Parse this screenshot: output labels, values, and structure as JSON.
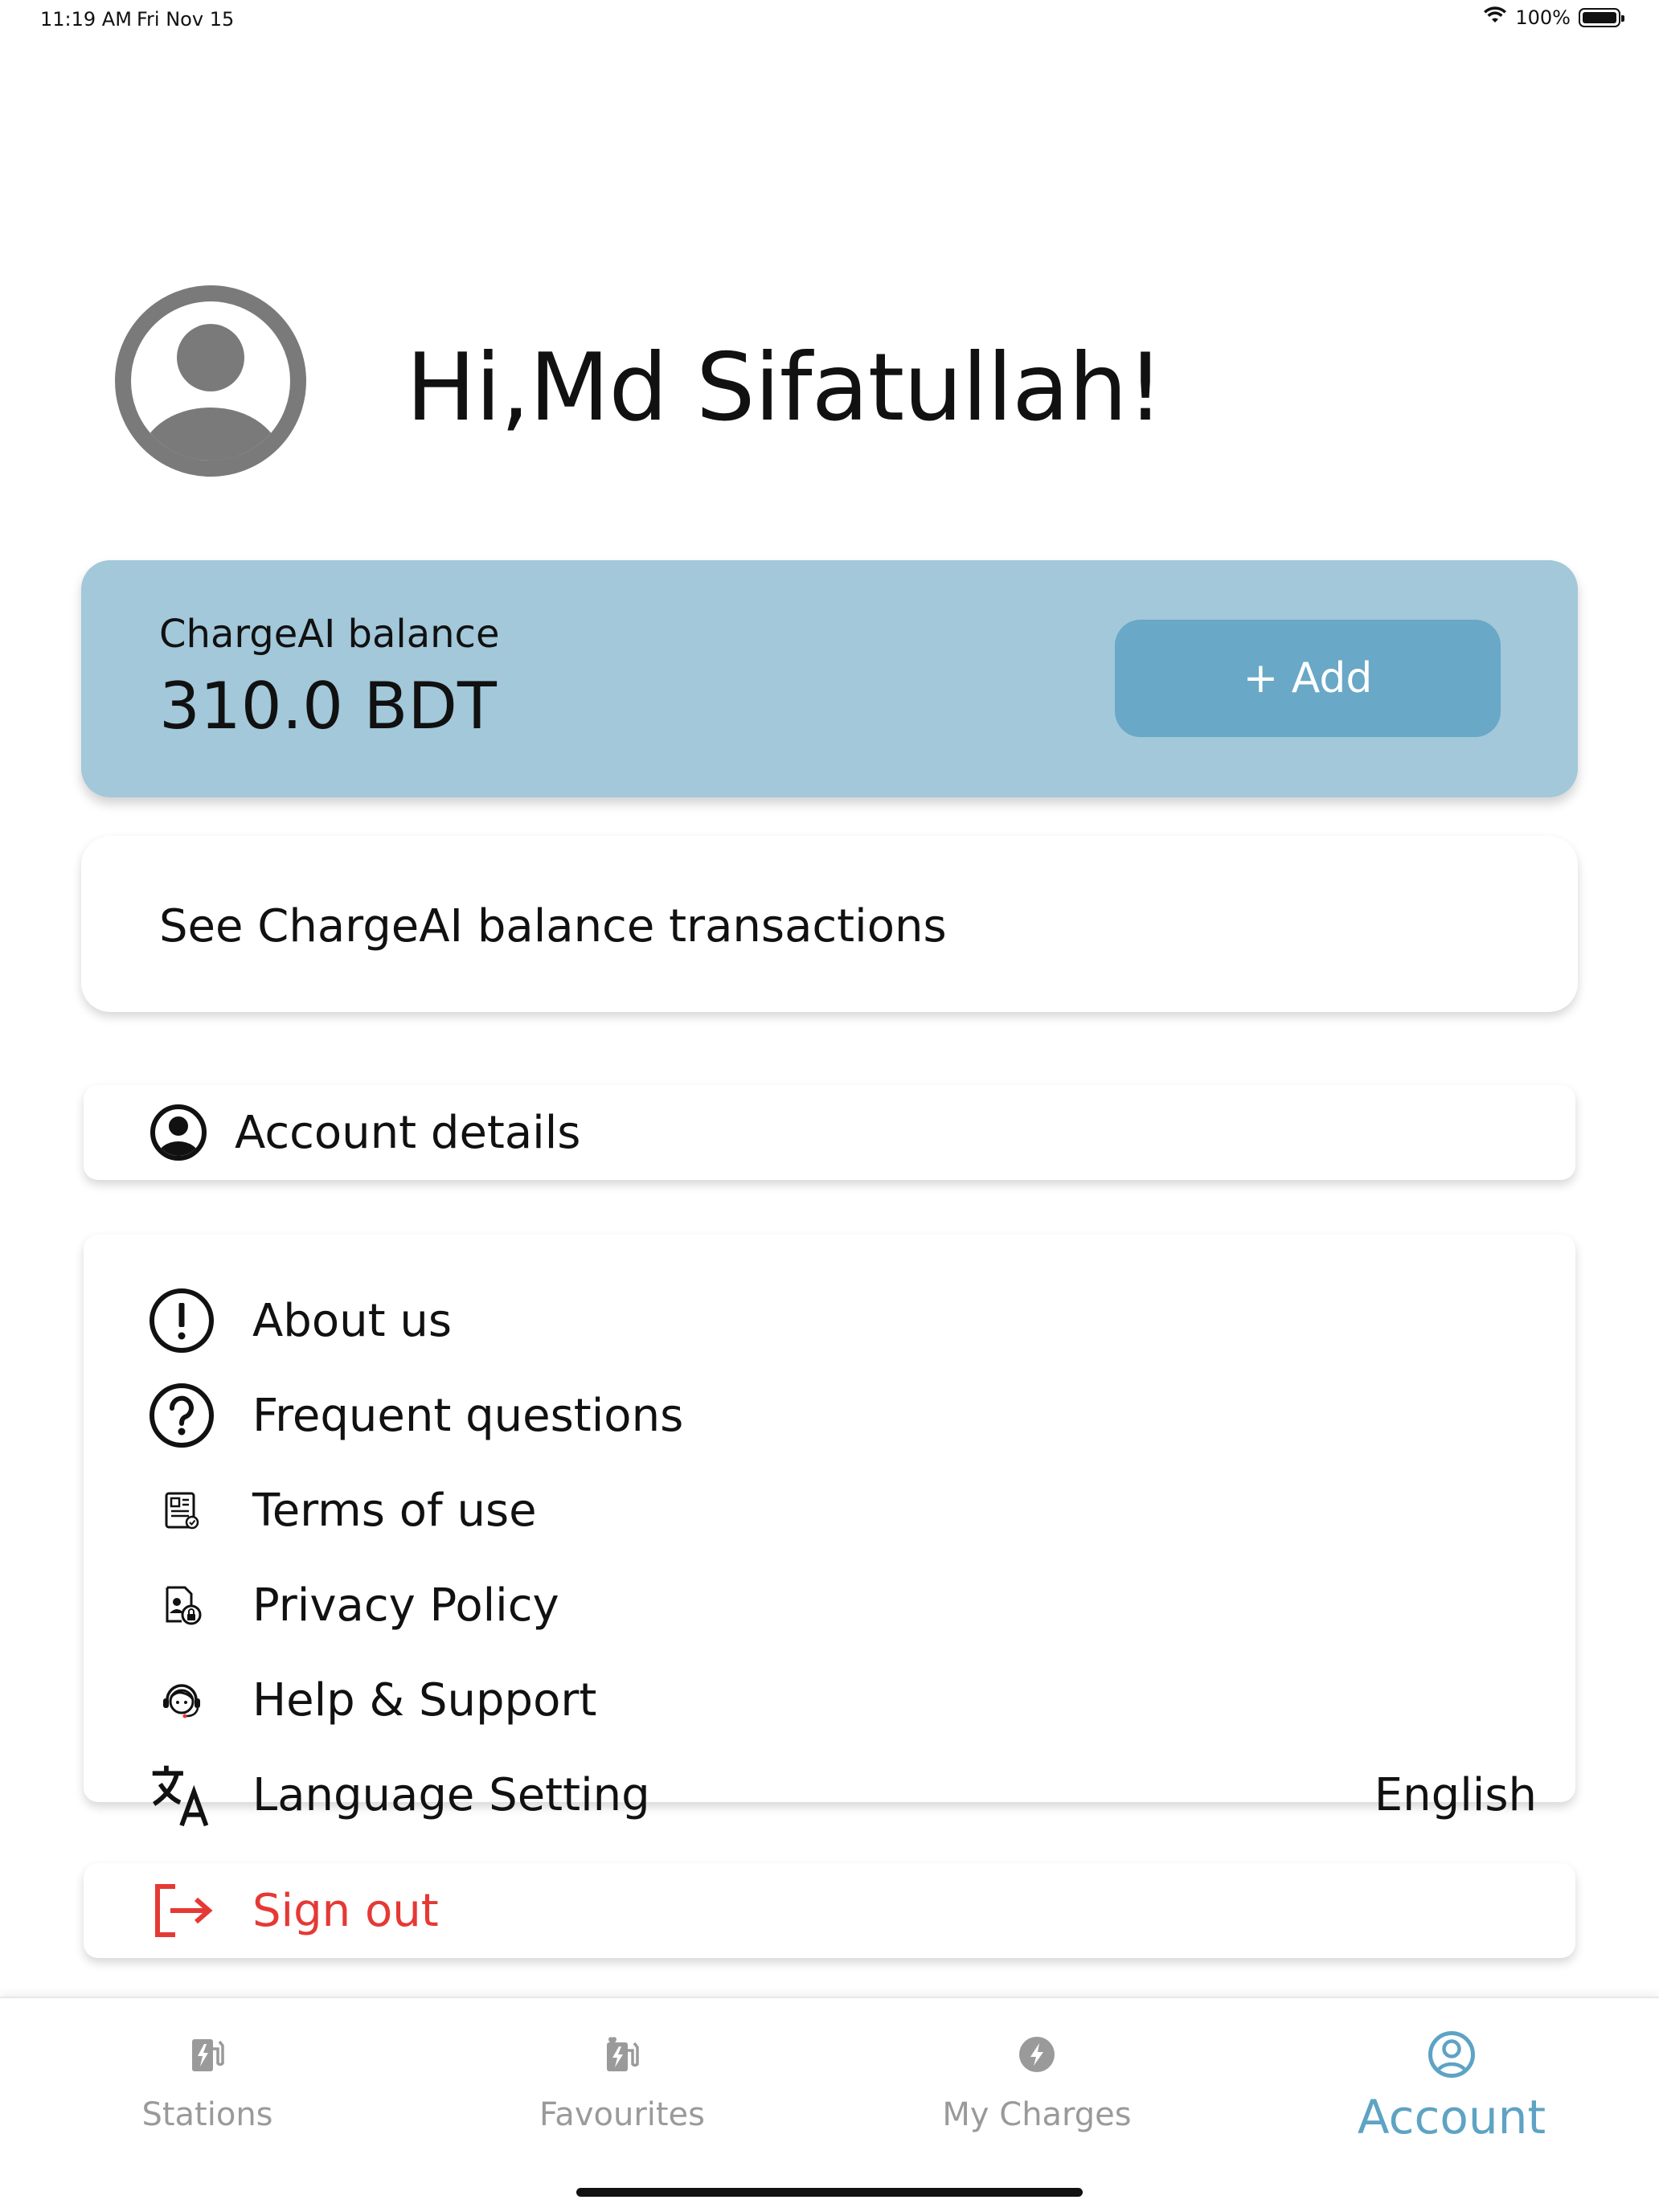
{
  "status_bar": {
    "time": "11:19 AM",
    "date": "Fri Nov 15",
    "battery": "100%"
  },
  "profile": {
    "greeting": "Hi,Md Sifatullah!"
  },
  "balance": {
    "label": "ChargeAI balance",
    "amount": "310.0 BDT",
    "add_label": "+ Add"
  },
  "transactions": {
    "label": "See ChargeAI balance transactions"
  },
  "account": {
    "label": "Account details",
    "icon": "account-circle-icon"
  },
  "menu": {
    "items": [
      {
        "label": "About us",
        "icon": "info-alert-icon"
      },
      {
        "label": "Frequent questions",
        "icon": "question-icon"
      },
      {
        "label": "Terms of use",
        "icon": "document-icon"
      },
      {
        "label": "Privacy Policy",
        "icon": "privacy-document-icon"
      },
      {
        "label": "Help & Support",
        "icon": "support-agent-icon"
      },
      {
        "label": "Language Setting",
        "icon": "translate-icon",
        "value": "English"
      }
    ]
  },
  "signout": {
    "label": "Sign out",
    "icon": "logout-icon",
    "color": "#e53935"
  },
  "nav": {
    "items": [
      {
        "label": "Stations",
        "icon": "ev-station-icon"
      },
      {
        "label": "Favourites",
        "icon": "favourite-station-icon"
      },
      {
        "label": "My Charges",
        "icon": "bolt-circle-icon"
      },
      {
        "label": "Account",
        "icon": "account-circle-icon",
        "active": true
      }
    ]
  },
  "colors": {
    "balance_card": "#a2c8da",
    "add_button": "#69a8c6",
    "accent": "#5ea3c4",
    "inactive": "#9a9a9a"
  }
}
